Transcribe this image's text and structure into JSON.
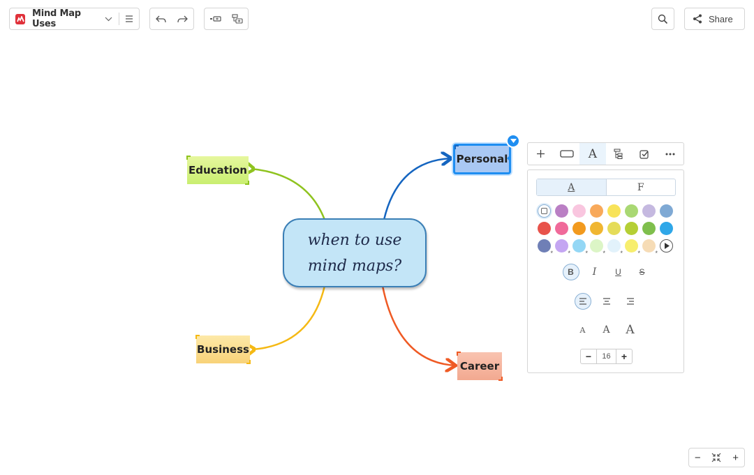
{
  "app": {
    "title": "Mind Map Uses",
    "share_label": "Share"
  },
  "toolbar": {
    "icons": [
      "logo-icon",
      "chevron-down-icon",
      "hamburger-menu-icon",
      "undo-icon",
      "redo-icon",
      "insert-sibling-icon",
      "insert-child-icon",
      "search-icon",
      "share-icon"
    ]
  },
  "map": {
    "central": {
      "line1": "when to use",
      "line2": "mind maps?"
    },
    "nodes": {
      "education": "Education",
      "personal": "Personal",
      "business": "Business",
      "career": "Career"
    },
    "colors": {
      "education": "#8fc31f",
      "personal": "#1565c0",
      "business": "#f5b914",
      "career": "#ef5a24",
      "selection": "#1f8ef1"
    }
  },
  "format_panel": {
    "tabs": [
      "+",
      "shape",
      "A",
      "layout",
      "task",
      "..."
    ],
    "segment": {
      "text": "A",
      "fill": "F"
    },
    "swatches": {
      "row1": [
        "#ba7fc4",
        "#f9c6df",
        "#f8a95a",
        "#f8e359",
        "#a9d873",
        "#c5b9e0",
        "#7fa9d4"
      ],
      "row2": [
        "#e8534b",
        "#f06a9a",
        "#f29a1e",
        "#f0b631",
        "#e5dc59",
        "#b5cf35",
        "#7fbf4d",
        "#2fa7e8"
      ],
      "row3": [
        "#6f7fb6",
        "#c4a6f2",
        "#94d7f5",
        "#dcf5c6",
        "#e2f2fb",
        "#f7ee6e",
        "#f6dcb6"
      ]
    },
    "text_style": {
      "bold": "B",
      "italic": "I",
      "underline": "U",
      "strike": "S"
    },
    "font_sizes": [
      "A",
      "A",
      "A"
    ],
    "size": {
      "value": "16",
      "minus": "−",
      "plus": "+"
    }
  },
  "zoom": {
    "minus": "−",
    "plus": "+"
  }
}
